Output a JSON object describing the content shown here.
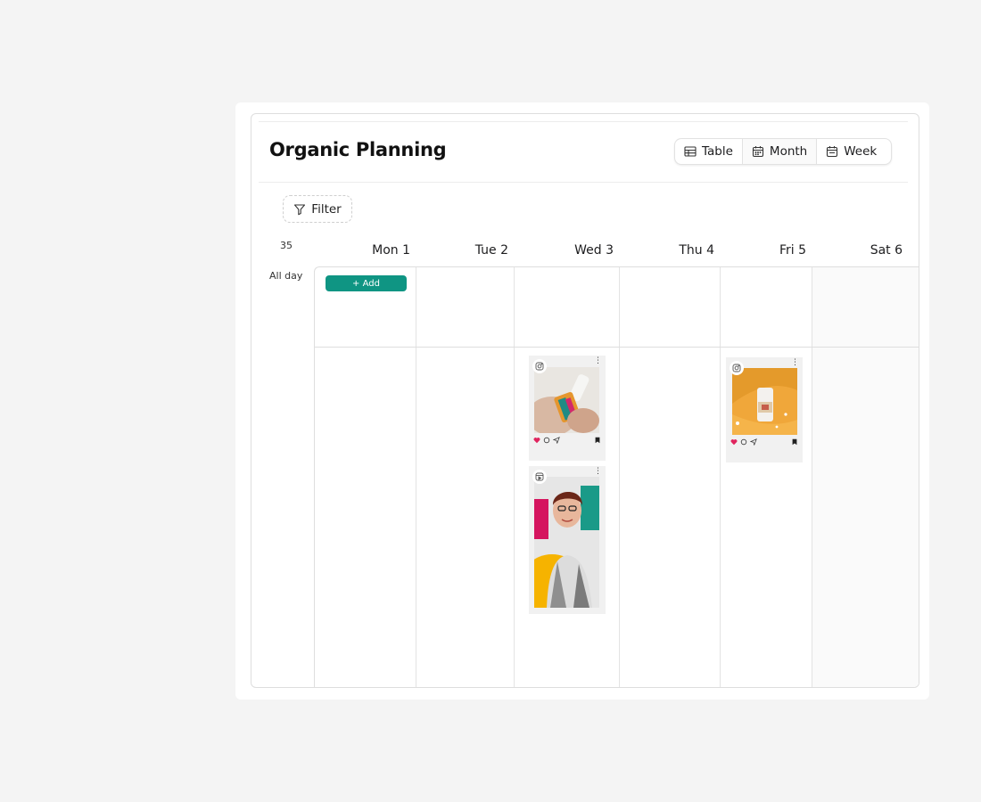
{
  "header": {
    "title": "Organic Planning",
    "views": [
      {
        "label": "Table",
        "icon": "table-icon"
      },
      {
        "label": "Month",
        "icon": "calendar-icon"
      },
      {
        "label": "Week",
        "icon": "calendar-icon"
      }
    ],
    "active_view": "Month"
  },
  "toolbar": {
    "filter_label": "Filter"
  },
  "calendar": {
    "week_number": "35",
    "allday_label": "All day",
    "days": [
      "Mon 1",
      "Tue 2",
      "Wed 3",
      "Thu 4",
      "Fri 5",
      "Sat 6"
    ],
    "add_label": "+ Add"
  },
  "posts": [
    {
      "day": "Wed 3",
      "type": "instagram-post",
      "icon": "instagram-icon"
    },
    {
      "day": "Wed 3",
      "type": "instagram-reel",
      "icon": "reel-icon"
    },
    {
      "day": "Fri 5",
      "type": "instagram-post",
      "icon": "instagram-icon"
    }
  ],
  "colors": {
    "accent": "#0f9583",
    "like": "#e0245e",
    "background": "#f4f4f4"
  }
}
